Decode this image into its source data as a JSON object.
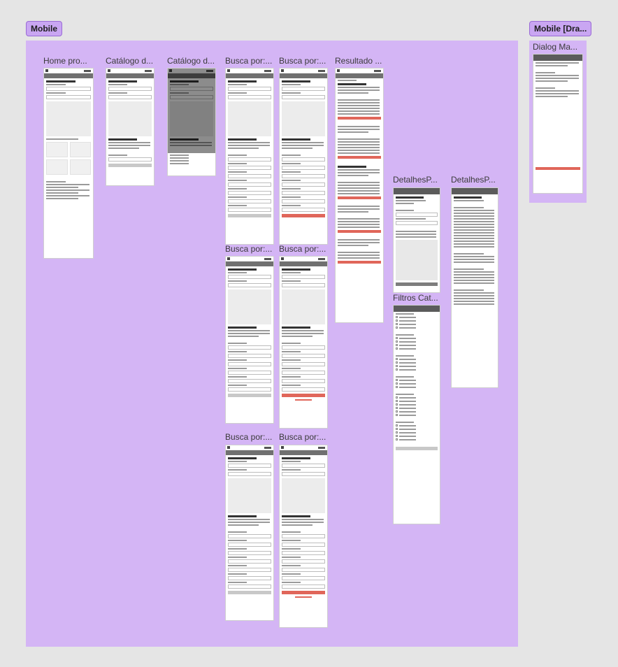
{
  "sections": {
    "mobile_label": "Mobile",
    "mobile_dra_label": "Mobile [Dra..."
  },
  "frames": {
    "home": "Home pro...",
    "catalogo1": "Catálogo d...",
    "catalogo2": "Catálogo d...",
    "busca1": "Busca por:...",
    "busca2": "Busca por:...",
    "resultado": "Resultado ...",
    "busca3": "Busca por:...",
    "busca4": "Busca por:...",
    "detalhes1": "DetalhesP...",
    "detalhes2": "DetalhesP...",
    "filtros": "Filtros Cat...",
    "busca5": "Busca por:...",
    "busca6": "Busca por:...",
    "dialog": "Dialog Ma..."
  },
  "colors": {
    "canvas": "#e5e5e5",
    "section": "#d4b5f5",
    "tag": "#c9a6f2",
    "accent": "#e0665a"
  }
}
